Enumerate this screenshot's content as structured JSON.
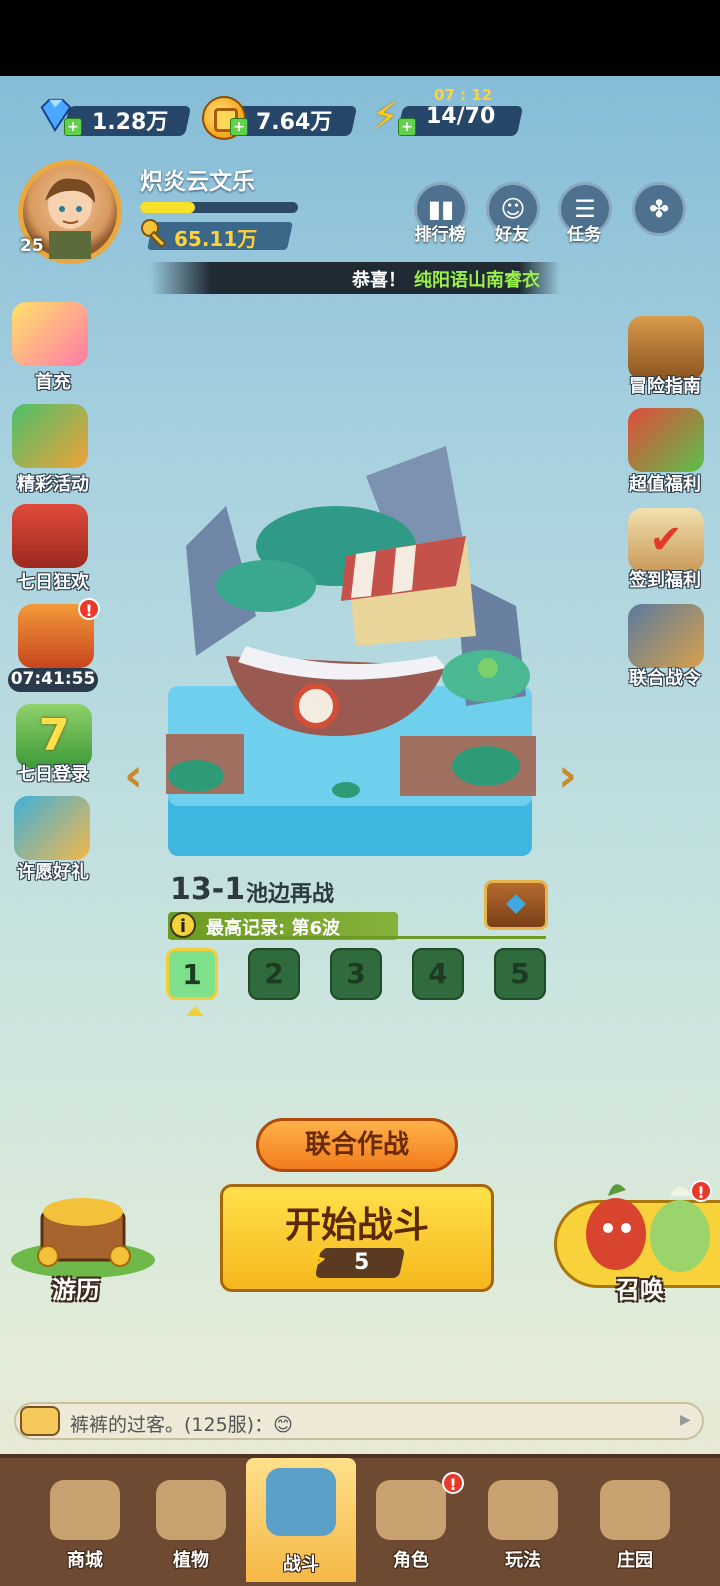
{
  "resources": {
    "gems": "1.28万",
    "gold": "7.64万",
    "energy": "14/70",
    "energy_timer": "07 : 12"
  },
  "player": {
    "name": "炽炎云文乐",
    "level": "25",
    "keys": "65.11万",
    "xp_progress": 0.35
  },
  "top_buttons": [
    {
      "label": "排行榜",
      "icon": "ranking-icon"
    },
    {
      "label": "好友",
      "icon": "friends-icon"
    },
    {
      "label": "任务",
      "icon": "task-icon"
    },
    {
      "label": "",
      "icon": "more-icon"
    }
  ],
  "ticker": {
    "prefix": "恭喜！",
    "highlight": "纯阳语山南睿衣"
  },
  "left_menu": [
    {
      "label": "首充",
      "icon": "first-recharge-icon"
    },
    {
      "label": "精彩活动",
      "icon": "events-icon"
    },
    {
      "label": "七日狂欢",
      "icon": "seven-day-carnival-icon"
    },
    {
      "label": "07:41:55",
      "icon": "gift-box-icon"
    },
    {
      "label": "七日登录",
      "icon": "seven-day-login-icon"
    },
    {
      "label": "许愿好礼",
      "icon": "wish-gift-icon"
    }
  ],
  "right_menu": [
    {
      "label": "冒险指南",
      "icon": "adventure-guide-icon"
    },
    {
      "label": "超值福利",
      "icon": "value-welfare-icon"
    },
    {
      "label": "签到福利",
      "icon": "check-in-icon"
    },
    {
      "label": "联合战令",
      "icon": "battle-pass-icon"
    }
  ],
  "stage": {
    "number": "13-1",
    "name": "池边再战",
    "record": "最高记录: 第6波",
    "waves": [
      "1",
      "2",
      "3",
      "4",
      "5"
    ],
    "selected_wave": 0
  },
  "actions": {
    "coop": "联合作战",
    "start": "开始战斗",
    "start_cost": "5",
    "travel": "游历",
    "summon": "召唤"
  },
  "chat": {
    "message": "裤裤的过客。(125服)：😊"
  },
  "nav": [
    {
      "label": "商城",
      "icon": "shop-icon"
    },
    {
      "label": "植物",
      "icon": "plants-icon"
    },
    {
      "label": "战斗",
      "icon": "battle-icon"
    },
    {
      "label": "角色",
      "icon": "character-icon"
    },
    {
      "label": "玩法",
      "icon": "gameplay-icon"
    },
    {
      "label": "庄园",
      "icon": "manor-icon"
    }
  ],
  "colors": {
    "accent": "#f6b71d",
    "record_bar": "#6c9a23",
    "alert": "#e8392b"
  }
}
